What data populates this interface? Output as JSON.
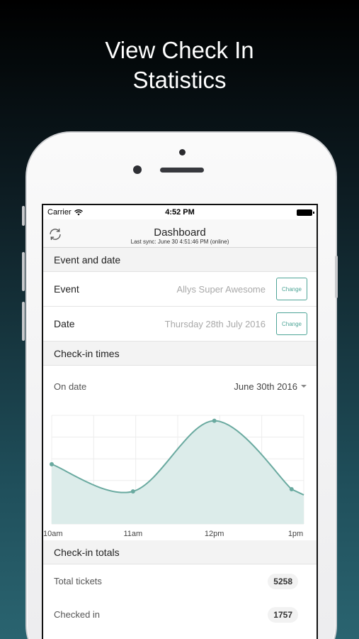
{
  "headline": {
    "line1": "View Check In",
    "line2": "Statistics"
  },
  "status_bar": {
    "carrier": "Carrier",
    "time": "4:52 PM"
  },
  "nav": {
    "title": "Dashboard",
    "subtitle": "Last sync: June 30 4:51:46 PM (online)"
  },
  "event_section": {
    "header": "Event and date",
    "event": {
      "label": "Event",
      "value": "Allys Super Awesome",
      "button": "Change"
    },
    "date": {
      "label": "Date",
      "value": "Thursday 28th July 2016",
      "button": "Change"
    }
  },
  "checkin_times": {
    "header": "Check-in times",
    "on_date_label": "On date",
    "selected_date": "June 30th 2016"
  },
  "chart_data": {
    "type": "area",
    "categories": [
      "10am",
      "11am",
      "12pm",
      "1pm"
    ],
    "x": [
      0,
      1,
      2,
      3
    ],
    "points": [
      {
        "x": 0,
        "y": 0.55
      },
      {
        "x": 1,
        "y": 0.3
      },
      {
        "x": 2,
        "y": 0.95
      },
      {
        "x": 2.95,
        "y": 0.32
      }
    ],
    "title": "",
    "xlabel": "",
    "ylabel": "",
    "grid": true,
    "fill_color": "#dcecea",
    "line_color": "#6aaaa0"
  },
  "checkin_totals": {
    "header": "Check-in totals",
    "rows": [
      {
        "label": "Total tickets",
        "value": "5258"
      },
      {
        "label": "Checked in",
        "value": "1757"
      }
    ]
  },
  "colors": {
    "accent": "#4ea597"
  }
}
